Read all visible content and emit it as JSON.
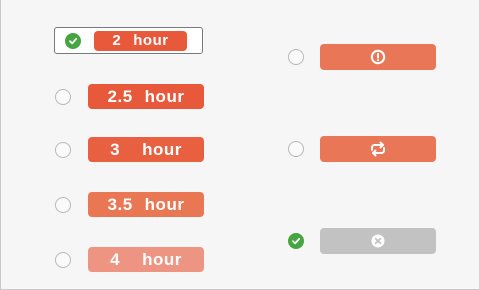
{
  "duration_options": [
    {
      "number": "2",
      "unit": "hour",
      "selected": true,
      "color": "#e8583a"
    },
    {
      "number": "2.5",
      "unit": "hour",
      "selected": false,
      "color": "#e8583a"
    },
    {
      "number": "3",
      "unit": "hour",
      "selected": false,
      "color": "#e8603f"
    },
    {
      "number": "3.5",
      "unit": "hour",
      "selected": false,
      "color": "#ea7754"
    },
    {
      "number": "4",
      "unit": "hour",
      "selected": false,
      "color": "#ee9482"
    }
  ],
  "action_options": [
    {
      "icon": "alert-circle-icon",
      "selected": false,
      "color": "#e97757"
    },
    {
      "icon": "repeat-icon",
      "selected": false,
      "color": "#e97757"
    },
    {
      "icon": "close-circle-icon",
      "selected": true,
      "color": "#c2c2c2"
    }
  ],
  "colors": {
    "check_green": "#46a541",
    "panel_background": "#f6f6f6"
  }
}
